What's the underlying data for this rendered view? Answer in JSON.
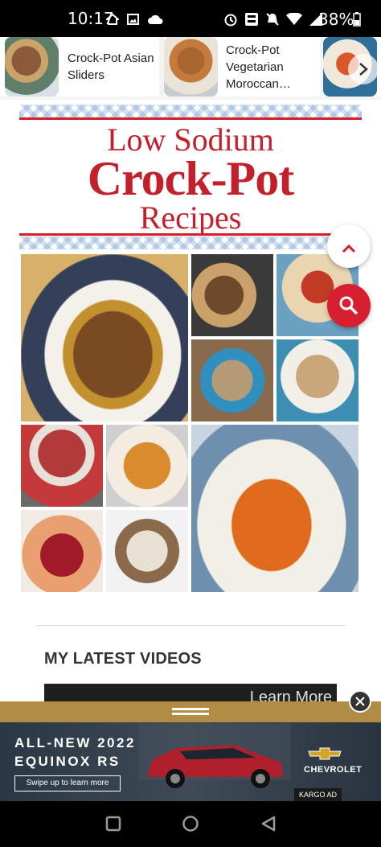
{
  "status_bar": {
    "time": "10:17",
    "battery": "38%",
    "icons": [
      "home-icon",
      "image-icon",
      "cloud-icon",
      "alarm-icon",
      "volte-icon",
      "mute-icon",
      "wifi-icon",
      "signal-icon",
      "battery-icon"
    ]
  },
  "related": {
    "items": [
      {
        "title": "Crock-Pot Asian Sliders"
      },
      {
        "title": "Crock-Pot Vegetarian Moroccan…"
      }
    ],
    "next_icon": "chevron-right-icon"
  },
  "banner": {
    "line1": "Low Sodium",
    "line2": "Crock-Pot",
    "line3": "Recipes"
  },
  "fabs": {
    "up_icon": "chevron-up-icon",
    "search_icon": "search-icon"
  },
  "latest_videos": {
    "heading": "MY LATEST VIDEOS",
    "learn_more": "Learn More"
  },
  "ad": {
    "headline1": "ALL-NEW 2022",
    "headline2": "EQUINOX RS",
    "cta": "Swipe up to learn more",
    "brand": "CHEVROLET",
    "network": "KARGO AD",
    "close_icon": "close-icon"
  },
  "nav": {
    "icons": [
      "recents-icon",
      "home-icon",
      "back-icon"
    ]
  },
  "colors": {
    "accent_red": "#d21f2b",
    "ad_bar": "#b08c44"
  }
}
